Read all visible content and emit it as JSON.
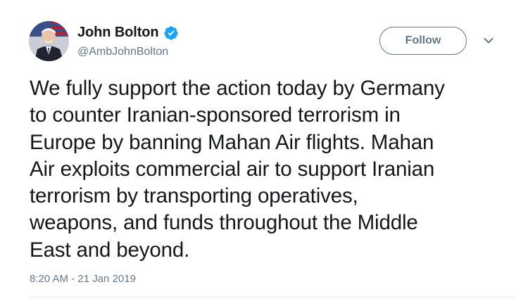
{
  "author": {
    "display_name": "John Bolton",
    "handle": "@AmbJohnBolton",
    "verified": true
  },
  "follow_button": {
    "label": "Follow"
  },
  "menu": {
    "icon": "chevron-down-icon"
  },
  "tweet": {
    "lines": [
      "We fully support the action today by Germany",
      "to counter Iranian-sponsored terrorism in",
      "Europe by banning Mahan Air flights. Mahan",
      "Air exploits commercial air to support Iranian",
      "terrorism by transporting operatives,",
      "weapons, and funds throughout the Middle",
      "East and beyond."
    ],
    "timestamp": "8:20 AM - 21 Jan 2019"
  },
  "colors": {
    "text_primary": "#14171a",
    "text_secondary": "#657786",
    "verified_blue": "#1da1f2",
    "divider": "#e6ecf0"
  }
}
